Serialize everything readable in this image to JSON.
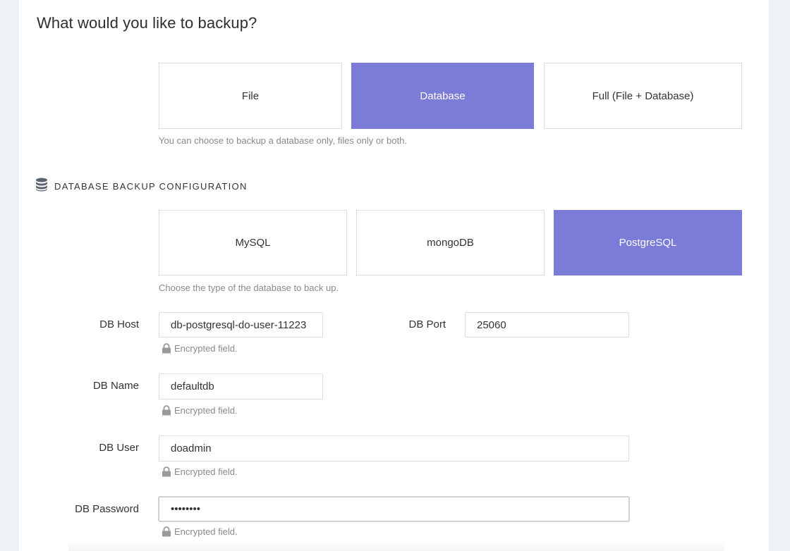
{
  "page": {
    "title": "What would you like to backup?"
  },
  "backup_type": {
    "options": [
      "File",
      "Database",
      "Full (File + Database)"
    ],
    "selected": "Database",
    "help": "You can choose to backup a database only, files only or both."
  },
  "db_section": {
    "title": "DATABASE BACKUP CONFIGURATION",
    "icon": "database-icon"
  },
  "db_type": {
    "options": [
      "MySQL",
      "mongoDB",
      "PostgreSQL"
    ],
    "selected": "PostgreSQL",
    "help": "Choose the type of the database to back up."
  },
  "fields": {
    "host": {
      "label": "DB Host",
      "value": "db-postgresql-do-user-11223"
    },
    "port": {
      "label": "DB Port",
      "value": "25060"
    },
    "name": {
      "label": "DB Name",
      "value": "defaultdb"
    },
    "user": {
      "label": "DB User",
      "value": "doadmin"
    },
    "password": {
      "label": "DB Password",
      "value": "••••••••"
    }
  },
  "encrypted_note": "Encrypted field.",
  "colors": {
    "accent": "#7b7bd8",
    "border": "#dedede",
    "muted_text": "#8a8a8a"
  }
}
